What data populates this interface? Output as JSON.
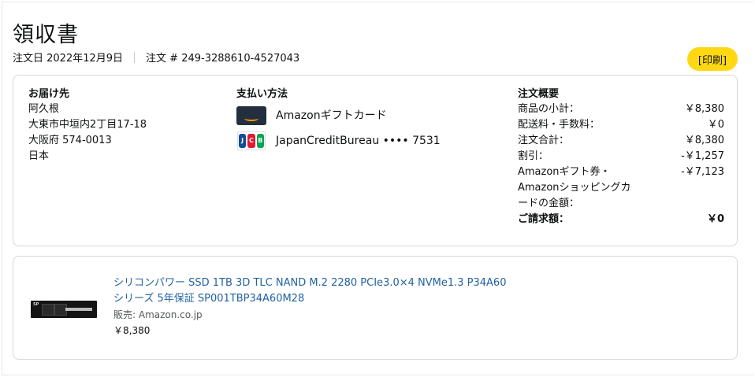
{
  "header": {
    "title": "領収書",
    "order_date": "注文日 2022年12月9日",
    "order_number": "注文 # 249-3288610-4527043",
    "print_label": "[印刷]"
  },
  "shipping": {
    "heading": "お届け先",
    "name": "阿久根",
    "line1": "大東市中垣内2丁目17-18",
    "line2": "大阪府 574-0013",
    "country": "日本"
  },
  "payment": {
    "heading": "支払い方法",
    "methods": [
      {
        "icon": "amazon-gift-card-icon",
        "label": "Amazonギフトカード"
      },
      {
        "icon": "jcb-card-icon",
        "label": "JapanCreditBureau •••• 7531"
      }
    ]
  },
  "summary": {
    "heading": "注文概要",
    "rows": [
      {
        "label": "商品の小計：",
        "value": "￥8,380"
      },
      {
        "label": "配送料・手数料：",
        "value": "￥0"
      },
      {
        "label": "注文合計：",
        "value": "￥8,380"
      },
      {
        "label": "割引：",
        "value": "-￥1,257"
      },
      {
        "label": "Amazonギフト券・Amazonショッピングカードの金額：",
        "value": "-￥7,123"
      },
      {
        "label": "ご請求額：",
        "value": "￥0"
      }
    ]
  },
  "item": {
    "name": "シリコンパワー SSD 1TB 3D TLC NAND M.2 2280 PCIe3.0×4 NVMe1.3 P34A60シリーズ 5年保証 SP001TBP34A60M28",
    "seller": "販売: Amazon.co.jp",
    "price": "￥8,380",
    "image_label": "SP"
  },
  "colors": {
    "print_button": "#ffd814",
    "link": "#2162a1",
    "border": "#d5d9d9"
  }
}
